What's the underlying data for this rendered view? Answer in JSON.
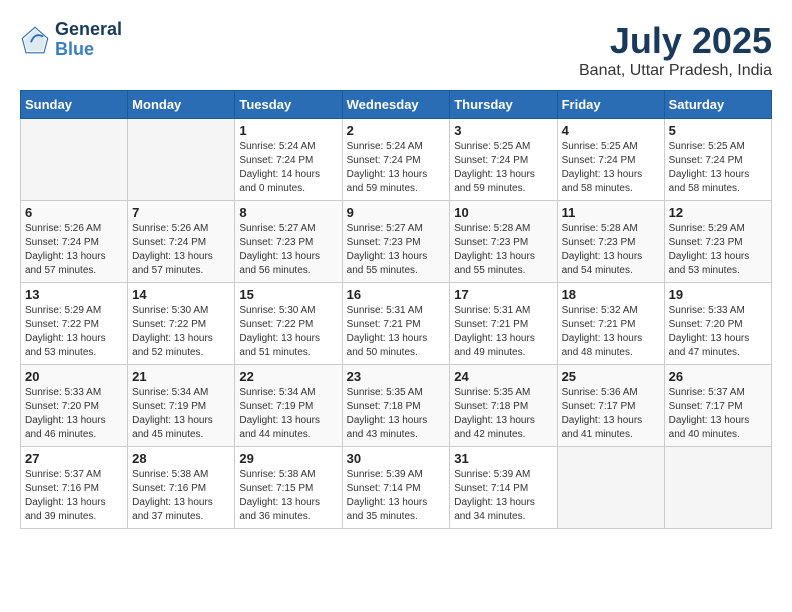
{
  "logo": {
    "line1": "General",
    "line2": "Blue"
  },
  "title": "July 2025",
  "location": "Banat, Uttar Pradesh, India",
  "weekdays": [
    "Sunday",
    "Monday",
    "Tuesday",
    "Wednesday",
    "Thursday",
    "Friday",
    "Saturday"
  ],
  "weeks": [
    [
      {
        "day": "",
        "info": ""
      },
      {
        "day": "",
        "info": ""
      },
      {
        "day": "1",
        "info": "Sunrise: 5:24 AM\nSunset: 7:24 PM\nDaylight: 14 hours\nand 0 minutes."
      },
      {
        "day": "2",
        "info": "Sunrise: 5:24 AM\nSunset: 7:24 PM\nDaylight: 13 hours\nand 59 minutes."
      },
      {
        "day": "3",
        "info": "Sunrise: 5:25 AM\nSunset: 7:24 PM\nDaylight: 13 hours\nand 59 minutes."
      },
      {
        "day": "4",
        "info": "Sunrise: 5:25 AM\nSunset: 7:24 PM\nDaylight: 13 hours\nand 58 minutes."
      },
      {
        "day": "5",
        "info": "Sunrise: 5:25 AM\nSunset: 7:24 PM\nDaylight: 13 hours\nand 58 minutes."
      }
    ],
    [
      {
        "day": "6",
        "info": "Sunrise: 5:26 AM\nSunset: 7:24 PM\nDaylight: 13 hours\nand 57 minutes."
      },
      {
        "day": "7",
        "info": "Sunrise: 5:26 AM\nSunset: 7:24 PM\nDaylight: 13 hours\nand 57 minutes."
      },
      {
        "day": "8",
        "info": "Sunrise: 5:27 AM\nSunset: 7:23 PM\nDaylight: 13 hours\nand 56 minutes."
      },
      {
        "day": "9",
        "info": "Sunrise: 5:27 AM\nSunset: 7:23 PM\nDaylight: 13 hours\nand 55 minutes."
      },
      {
        "day": "10",
        "info": "Sunrise: 5:28 AM\nSunset: 7:23 PM\nDaylight: 13 hours\nand 55 minutes."
      },
      {
        "day": "11",
        "info": "Sunrise: 5:28 AM\nSunset: 7:23 PM\nDaylight: 13 hours\nand 54 minutes."
      },
      {
        "day": "12",
        "info": "Sunrise: 5:29 AM\nSunset: 7:23 PM\nDaylight: 13 hours\nand 53 minutes."
      }
    ],
    [
      {
        "day": "13",
        "info": "Sunrise: 5:29 AM\nSunset: 7:22 PM\nDaylight: 13 hours\nand 53 minutes."
      },
      {
        "day": "14",
        "info": "Sunrise: 5:30 AM\nSunset: 7:22 PM\nDaylight: 13 hours\nand 52 minutes."
      },
      {
        "day": "15",
        "info": "Sunrise: 5:30 AM\nSunset: 7:22 PM\nDaylight: 13 hours\nand 51 minutes."
      },
      {
        "day": "16",
        "info": "Sunrise: 5:31 AM\nSunset: 7:21 PM\nDaylight: 13 hours\nand 50 minutes."
      },
      {
        "day": "17",
        "info": "Sunrise: 5:31 AM\nSunset: 7:21 PM\nDaylight: 13 hours\nand 49 minutes."
      },
      {
        "day": "18",
        "info": "Sunrise: 5:32 AM\nSunset: 7:21 PM\nDaylight: 13 hours\nand 48 minutes."
      },
      {
        "day": "19",
        "info": "Sunrise: 5:33 AM\nSunset: 7:20 PM\nDaylight: 13 hours\nand 47 minutes."
      }
    ],
    [
      {
        "day": "20",
        "info": "Sunrise: 5:33 AM\nSunset: 7:20 PM\nDaylight: 13 hours\nand 46 minutes."
      },
      {
        "day": "21",
        "info": "Sunrise: 5:34 AM\nSunset: 7:19 PM\nDaylight: 13 hours\nand 45 minutes."
      },
      {
        "day": "22",
        "info": "Sunrise: 5:34 AM\nSunset: 7:19 PM\nDaylight: 13 hours\nand 44 minutes."
      },
      {
        "day": "23",
        "info": "Sunrise: 5:35 AM\nSunset: 7:18 PM\nDaylight: 13 hours\nand 43 minutes."
      },
      {
        "day": "24",
        "info": "Sunrise: 5:35 AM\nSunset: 7:18 PM\nDaylight: 13 hours\nand 42 minutes."
      },
      {
        "day": "25",
        "info": "Sunrise: 5:36 AM\nSunset: 7:17 PM\nDaylight: 13 hours\nand 41 minutes."
      },
      {
        "day": "26",
        "info": "Sunrise: 5:37 AM\nSunset: 7:17 PM\nDaylight: 13 hours\nand 40 minutes."
      }
    ],
    [
      {
        "day": "27",
        "info": "Sunrise: 5:37 AM\nSunset: 7:16 PM\nDaylight: 13 hours\nand 39 minutes."
      },
      {
        "day": "28",
        "info": "Sunrise: 5:38 AM\nSunset: 7:16 PM\nDaylight: 13 hours\nand 37 minutes."
      },
      {
        "day": "29",
        "info": "Sunrise: 5:38 AM\nSunset: 7:15 PM\nDaylight: 13 hours\nand 36 minutes."
      },
      {
        "day": "30",
        "info": "Sunrise: 5:39 AM\nSunset: 7:14 PM\nDaylight: 13 hours\nand 35 minutes."
      },
      {
        "day": "31",
        "info": "Sunrise: 5:39 AM\nSunset: 7:14 PM\nDaylight: 13 hours\nand 34 minutes."
      },
      {
        "day": "",
        "info": ""
      },
      {
        "day": "",
        "info": ""
      }
    ]
  ]
}
